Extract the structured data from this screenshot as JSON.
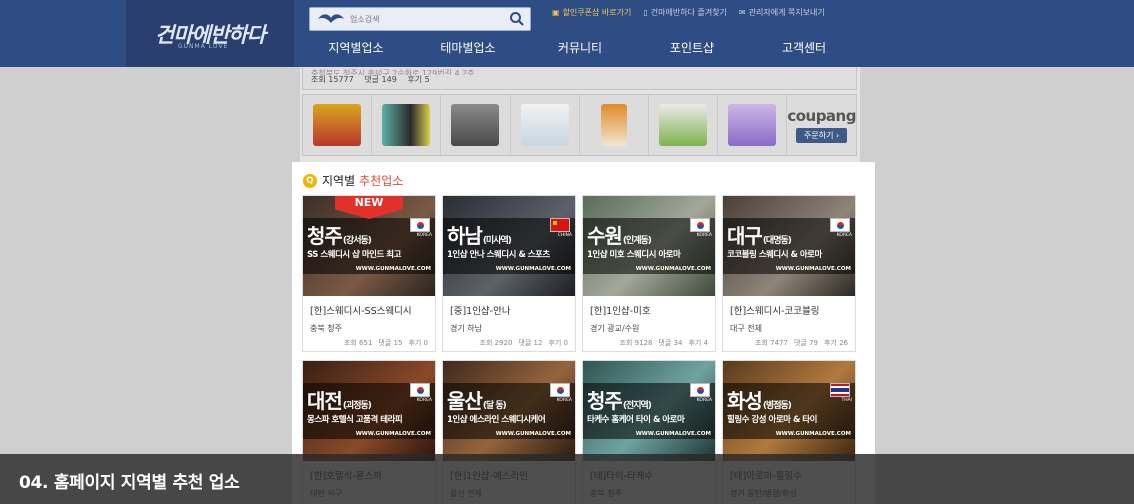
{
  "header": {
    "logo": "건마에반하다",
    "logo_sub": "GUNMA LOVE",
    "search": {
      "placeholder": "업소검색",
      "value": "업소검색"
    },
    "toplinks": [
      {
        "label": "할인쿠폰샵 바로가기",
        "icon": "gift-icon"
      },
      {
        "label": "건마에반하다 즐겨찾기",
        "icon": "bookmark-icon"
      },
      {
        "label": "관리자에게 쪽지보내기",
        "icon": "mail-icon"
      }
    ],
    "nav": [
      "지역별업소",
      "테마별업소",
      "커뮤니티",
      "포인트샵",
      "고객센터"
    ]
  },
  "background": {
    "meta_line": "충청북도 청주시 흥덕구 2순환로 129번길 4 2층",
    "views": "조회 15777",
    "comments": "댓글 149",
    "reviews": "후기 5",
    "coupang_logo": "coupang",
    "coupang_button": "주문하기 ›"
  },
  "section": {
    "title_prefix": "지역별",
    "title_highlight": "추천업소",
    "accent": "#e24a33"
  },
  "cards": [
    {
      "city": "청주",
      "district": "(강서동)",
      "tagline": "SS 스웨디시 샵 마인드 최고",
      "site": "WWW.GUNMALOVE.COM",
      "flag": "KOREA",
      "badge": "NEW",
      "name": "[한]스웨디시-SS스웨디시",
      "region": "충북 청주",
      "views": "조회 651",
      "comments": "댓글 15",
      "reviews": "후기 0"
    },
    {
      "city": "하남",
      "district": "(미사역)",
      "tagline": "1인샵 안나 스웨디시 & 스포츠",
      "site": "WWW.GUNMALOVE.COM",
      "flag": "CHINA",
      "name": "[중]1인샵-안나",
      "region": "경기 하남",
      "views": "조회 2920",
      "comments": "댓글 12",
      "reviews": "후기 0"
    },
    {
      "city": "수원",
      "district": "(인계동)",
      "tagline": "1인샵 미호 스웨디시 아로마",
      "site": "WWW.GUNMALOVE.COM",
      "flag": "KOREA",
      "name": "[한]1인샵-미호",
      "region": "경기 광교/수원",
      "views": "조회 9128",
      "comments": "댓글 34",
      "reviews": "후기 4"
    },
    {
      "city": "대구",
      "district": "(대명동)",
      "tagline": "코코블링 스웨디시 & 아로마",
      "site": "WWW.GUNMALOVE.COM",
      "flag": "KOREA",
      "name": "[한]스웨디시-코코블링",
      "region": "대구 전체",
      "views": "조회 7477",
      "comments": "댓글 79",
      "reviews": "후기 26"
    },
    {
      "city": "대전",
      "district": "(괴정동)",
      "tagline": "몽스파 호텔식 고품격 테라피",
      "site": "WWW.GUNMALOVE.COM",
      "flag": "KOREA",
      "name": "[한]호텔식-몽스파",
      "region": "대전 서구",
      "views": "",
      "comments": "",
      "reviews": ""
    },
    {
      "city": "울산",
      "district": "(달 동)",
      "tagline": "1인샵 에스라인 스웨디시케어",
      "site": "WWW.GUNMALOVE.COM",
      "flag": "KOREA",
      "name": "[한]1인샵-에스라인",
      "region": "울산 전체",
      "views": "",
      "comments": "",
      "reviews": ""
    },
    {
      "city": "청주",
      "district": "(전지역)",
      "tagline": "타케수 홈케어 타이 & 아로마",
      "site": "WWW.GUNMALOVE.COM",
      "flag": "KOREA",
      "name": "[태]타이-타케수",
      "region": "충북 청주",
      "views": "",
      "comments": "",
      "reviews": ""
    },
    {
      "city": "화성",
      "district": "(병점동)",
      "tagline": "힐링수 강성 아로마 & 타이",
      "site": "WWW.GUNMALOVE.COM",
      "flag": "THAI",
      "name": "[태]아로마-힐링수",
      "region": "경기 동탄/병점/화성",
      "views": "",
      "comments": "",
      "reviews": ""
    }
  ],
  "caption": "04. 홈페이지 지역별 추천 업소"
}
